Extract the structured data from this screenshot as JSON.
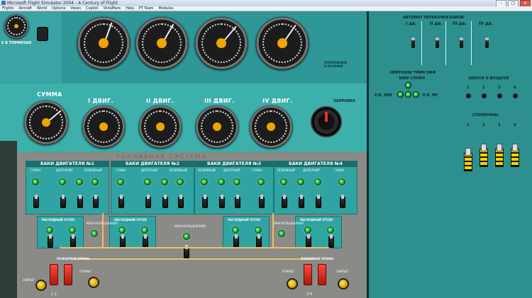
{
  "window": {
    "title": "Microsoft Flight Simulator 2004 - A Century of Flight",
    "minimize": "–",
    "maximize": "□",
    "close": "✕"
  },
  "menu": [
    "Flights",
    "Aircraft",
    "World",
    "Options",
    "Views",
    "Copilot",
    "VistaMare",
    "Help",
    "PT Team",
    "Modules"
  ],
  "left_panel": {
    "brake_label": "Е В ТОРМОЗАХ",
    "total_label": "СУММА",
    "engines": [
      "I ДВИГ.",
      "II ДВИГ.",
      "III ДВИГ.",
      "IV ДВИГ."
    ],
    "fill_label": "ЗАПРАВКА",
    "warn_label": "ПОМПАЖНЫЕ\nВ КАЛЛИНЕ"
  },
  "fuel_system": {
    "title": "ТОПЛИВНАЯ СИСТЕМА",
    "tanks": [
      {
        "label": "БАКИ ДВИГАТЕЛЯ №1"
      },
      {
        "label": "БАКИ ДВИГАТЕЛЯ №2"
      },
      {
        "label": "БАКИ ДВИГАТЕЛЯ №3"
      },
      {
        "label": "БАКИ ДВИГАТЕЛЯ №4"
      }
    ],
    "sub_labels": [
      "ГЛАВН.",
      "ДОПОЛНИТ.",
      "РЕЗЕРВНЫЙ"
    ],
    "drain_label": "ДРЕН.",
    "sump_label": "РАСХОДНЫЙ ОТСЕК",
    "ring_label": "КРАН КОЛЬЦЕВАНИЯ",
    "fire_valves": "ПОЖАРНЫЕ КРАНЫ",
    "close_label": "ЗАКРЫТ",
    "open_label": "ОТКРЫТ",
    "num_left": "1 2",
    "num_right": "3 4"
  },
  "right_panel": {
    "auto_transfer_title": "АВТОМАТ ПЕРЕКАЧКИ БАКОВ",
    "engine_cols": [
      "I дв.",
      "II дв.",
      "III дв.",
      "IV дв."
    ],
    "trim_title": "НЕЙТРАЛИ ТРИМ ЭФФ",
    "spoiler_label": "ЭЛЕР СПОЙЛ",
    "rv_left": "Р.В. ЛЕВ",
    "rv_right": "Р.В. ПР",
    "air_start_title": "ЗАПУСК В ВОЗДУХЕ",
    "air_start_nums": [
      "1",
      "2",
      "3",
      "4"
    ],
    "stop_title": "СТОПКРАНЫ",
    "stop_nums": [
      "1",
      "2",
      "3",
      "4"
    ]
  },
  "colors": {
    "panel_teal": "#3aa3a3",
    "right_teal": "#2d8f8e",
    "fuel_grey": "#8a8a86",
    "gauge_hub": "#f2a400",
    "pipe": "#e9c069",
    "fire_red": "#d6281b"
  }
}
